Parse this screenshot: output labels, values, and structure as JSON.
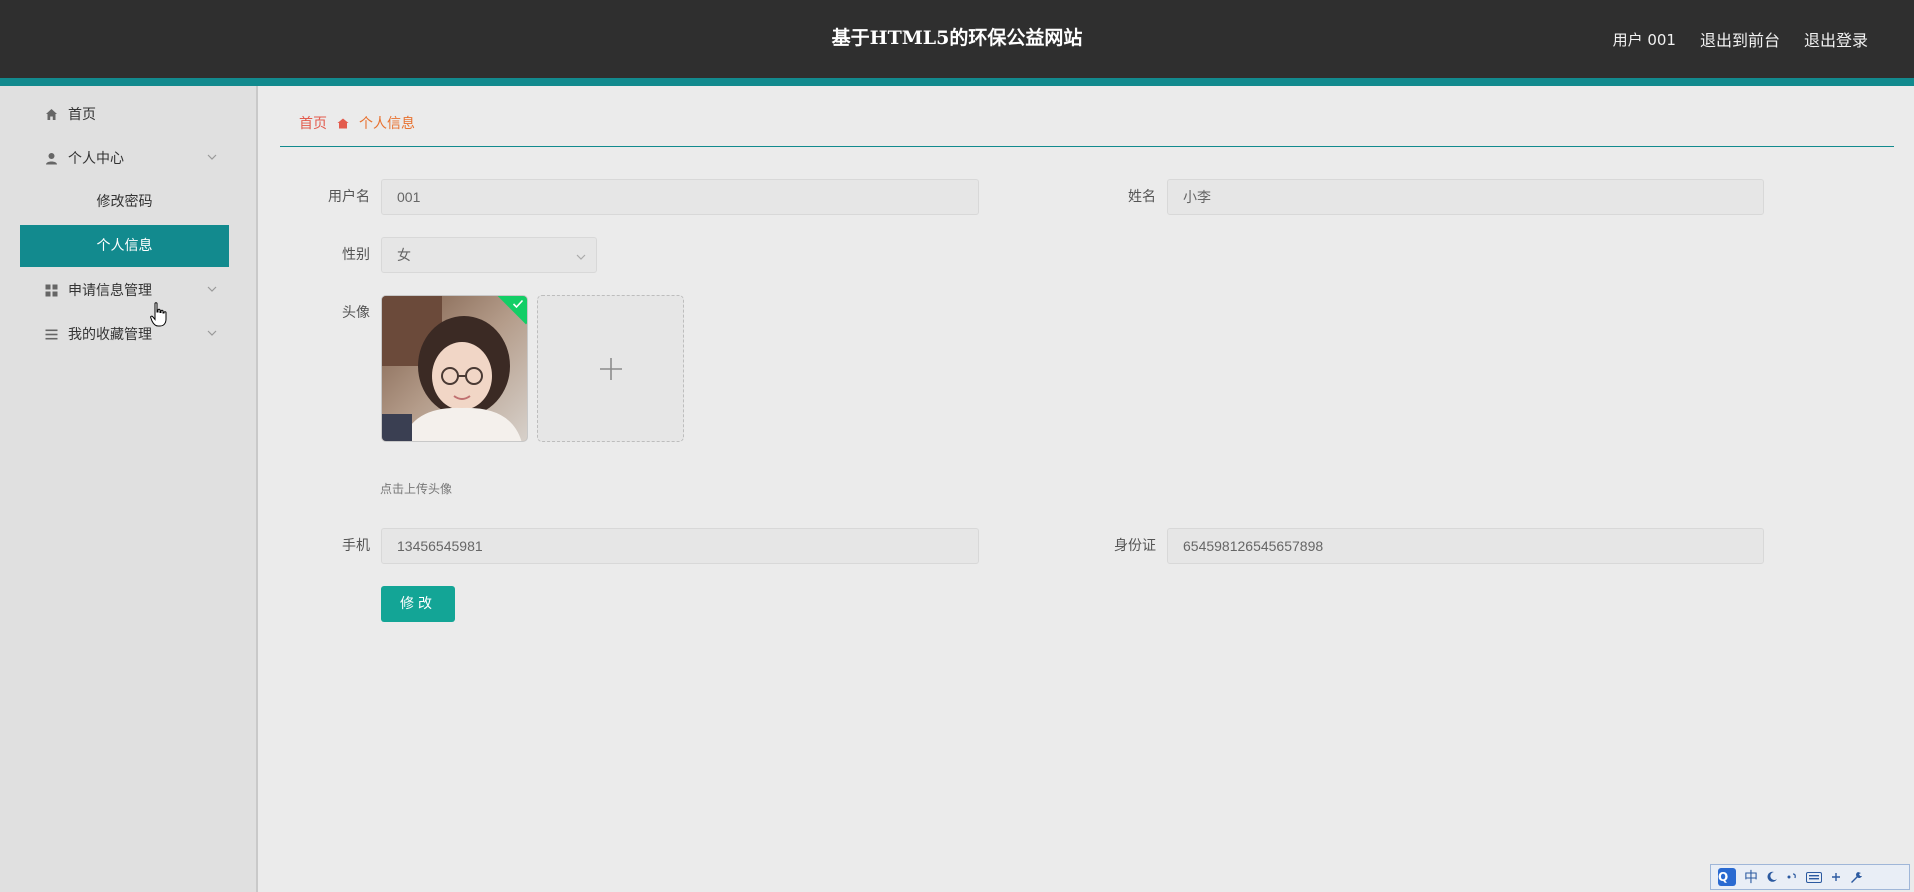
{
  "header": {
    "site_title": "基于HTML5的环保公益网站",
    "user_label": "用户 001",
    "back_to_front": "退出到前台",
    "logout": "退出登录"
  },
  "sidebar": {
    "items": [
      {
        "label": "首页",
        "icon": "home-icon"
      },
      {
        "label": "个人中心",
        "icon": "user-icon",
        "expanded": true,
        "children": [
          {
            "label": "修改密码",
            "active": false
          },
          {
            "label": "个人信息",
            "active": true
          }
        ]
      },
      {
        "label": "申请信息管理",
        "icon": "grid-icon"
      },
      {
        "label": "我的收藏管理",
        "icon": "list-icon"
      }
    ]
  },
  "breadcrumb": {
    "home": "首页",
    "current": "个人信息"
  },
  "form": {
    "username_label": "用户名",
    "username_value": "001",
    "name_label": "姓名",
    "name_value": "小李",
    "gender_label": "性别",
    "gender_value": "女",
    "avatar_label": "头像",
    "avatar_hint": "点击上传头像",
    "phone_label": "手机",
    "phone_value": "13456545981",
    "idcard_label": "身份证",
    "idcard_value": "654598126545657898",
    "submit_label": "修改"
  },
  "ime": {
    "mode": "中"
  },
  "colors": {
    "header_bg": "#2f2f2f",
    "accent_teal": "#128a8e",
    "button_green": "#13a596",
    "breadcrumb_home": "#e35b4d",
    "breadcrumb_current": "#e8712f"
  }
}
